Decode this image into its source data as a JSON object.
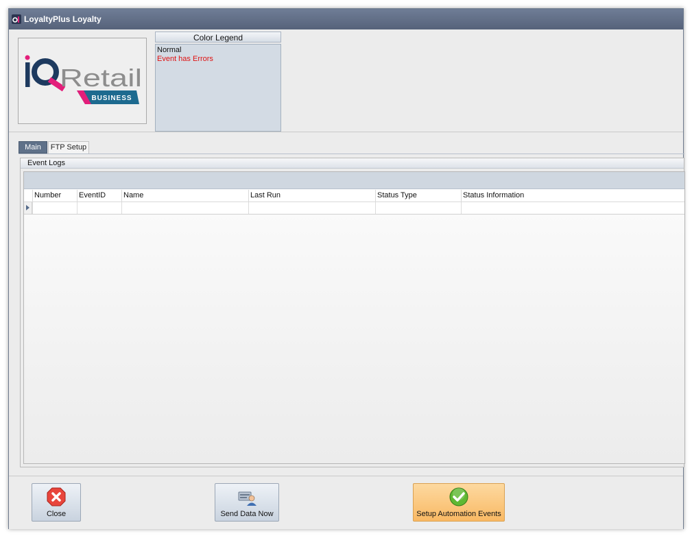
{
  "window": {
    "title": "LoyaltyPlus Loyalty"
  },
  "logo": {
    "brand_left": "iQ",
    "brand_right": "Retail",
    "badge": "BUSINESS"
  },
  "legend": {
    "title": "Color Legend",
    "items": [
      {
        "label": "Normal",
        "color": "#111111"
      },
      {
        "label": "Event has Errors",
        "color": "#e01010"
      }
    ]
  },
  "tabs": [
    {
      "label": "Main",
      "active": true
    },
    {
      "label": "FTP Setup",
      "active": false
    }
  ],
  "event_logs": {
    "title": "Event Logs",
    "columns": [
      "Number",
      "EventID",
      "Name",
      "Last Run",
      "Status Type",
      "Status Information"
    ],
    "rows": []
  },
  "footer": {
    "close_label": "Close",
    "send_label": "Send Data Now",
    "setup_label": "Setup Automation Events"
  },
  "icons": {
    "app": "app-logo-icon",
    "close": "close-x-icon",
    "send": "send-data-icon",
    "setup": "checkmark-icon"
  },
  "colors": {
    "accent": "#5f7189",
    "error": "#e01010",
    "setup_button": "#f9b964"
  }
}
